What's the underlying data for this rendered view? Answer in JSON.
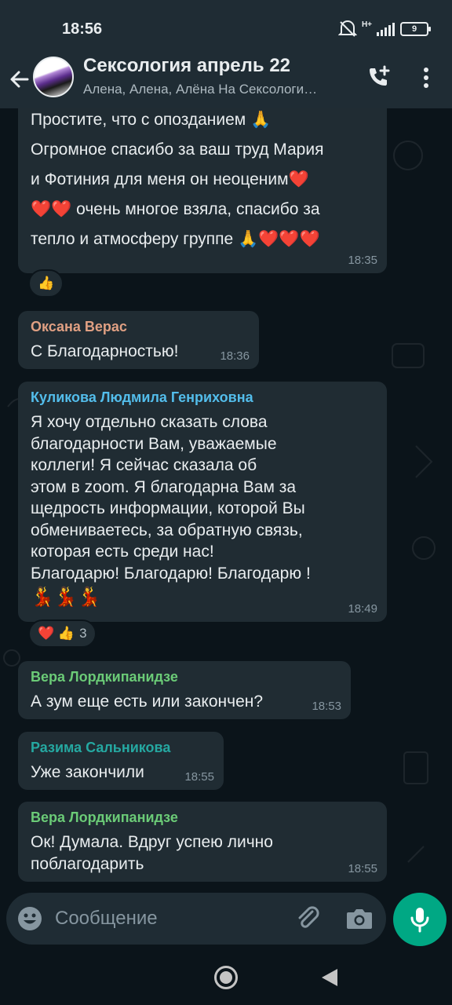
{
  "status_bar": {
    "time": "18:56",
    "network": "H+",
    "battery": "9"
  },
  "header": {
    "title": "Сексология апрель 22",
    "subtitle": "Алена, Алена, Алёна На Сексологи…"
  },
  "messages": [
    {
      "lines": [
        "Простите, что с опозданием 🙏",
        "Огромное спасибо за ваш труд Мария",
        "и Фотиния для меня он неоценим❤️",
        "❤️❤️ очень многое взяла, спасибо за",
        "тепло и атмосферу группе 🙏❤️❤️❤️"
      ],
      "time": "18:35"
    },
    {
      "sender": "Оксана Верас",
      "sender_color": "#e0a083",
      "lines": [
        "С Благодарностью!"
      ],
      "time": "18:36"
    },
    {
      "sender": "Куликова Людмила Генриховна",
      "sender_color": "#53bdeb",
      "lines": [
        "Я хочу отдельно сказать слова",
        "благодарности Вам, уважаемые",
        "коллеги! Я сейчас сказала об",
        "этом в zoom. Я благодарна Вам за",
        "щедрость информации, которой Вы",
        "обмениваетесь, за обратную связь,",
        "которая есть среди нас!",
        "Благодарю! Благодарю! Благодарю !",
        "💃💃💃"
      ],
      "time": "18:49"
    },
    {
      "sender": "Вера Лордкипанидзе",
      "sender_color": "#6bcb77",
      "lines": [
        "А зум еще есть или закончен?"
      ],
      "time": "18:53"
    },
    {
      "sender": "Разима Сальникова",
      "sender_color": "#25a8a1",
      "lines": [
        "Уже закончили"
      ],
      "time": "18:55"
    },
    {
      "sender": "Вера Лордкипанидзе",
      "sender_color": "#6bcb77",
      "lines": [
        "Ок! Думала. Вдруг успею лично",
        "поблагодарить"
      ],
      "time": "18:55"
    }
  ],
  "reactions": [
    {
      "emojis": "👍",
      "count": ""
    },
    {
      "emojis": "❤️ 👍",
      "count": "3"
    }
  ],
  "input": {
    "placeholder": "Сообщение"
  },
  "colors": {
    "accent": "#00a884",
    "bubble": "#202c33",
    "background": "#0b141a"
  },
  "icons": [
    "back-arrow-icon",
    "add-call-icon",
    "more-vert-icon",
    "emoji-icon",
    "attach-icon",
    "camera-icon",
    "mic-icon",
    "nav-home-icon",
    "nav-back-icon"
  ]
}
